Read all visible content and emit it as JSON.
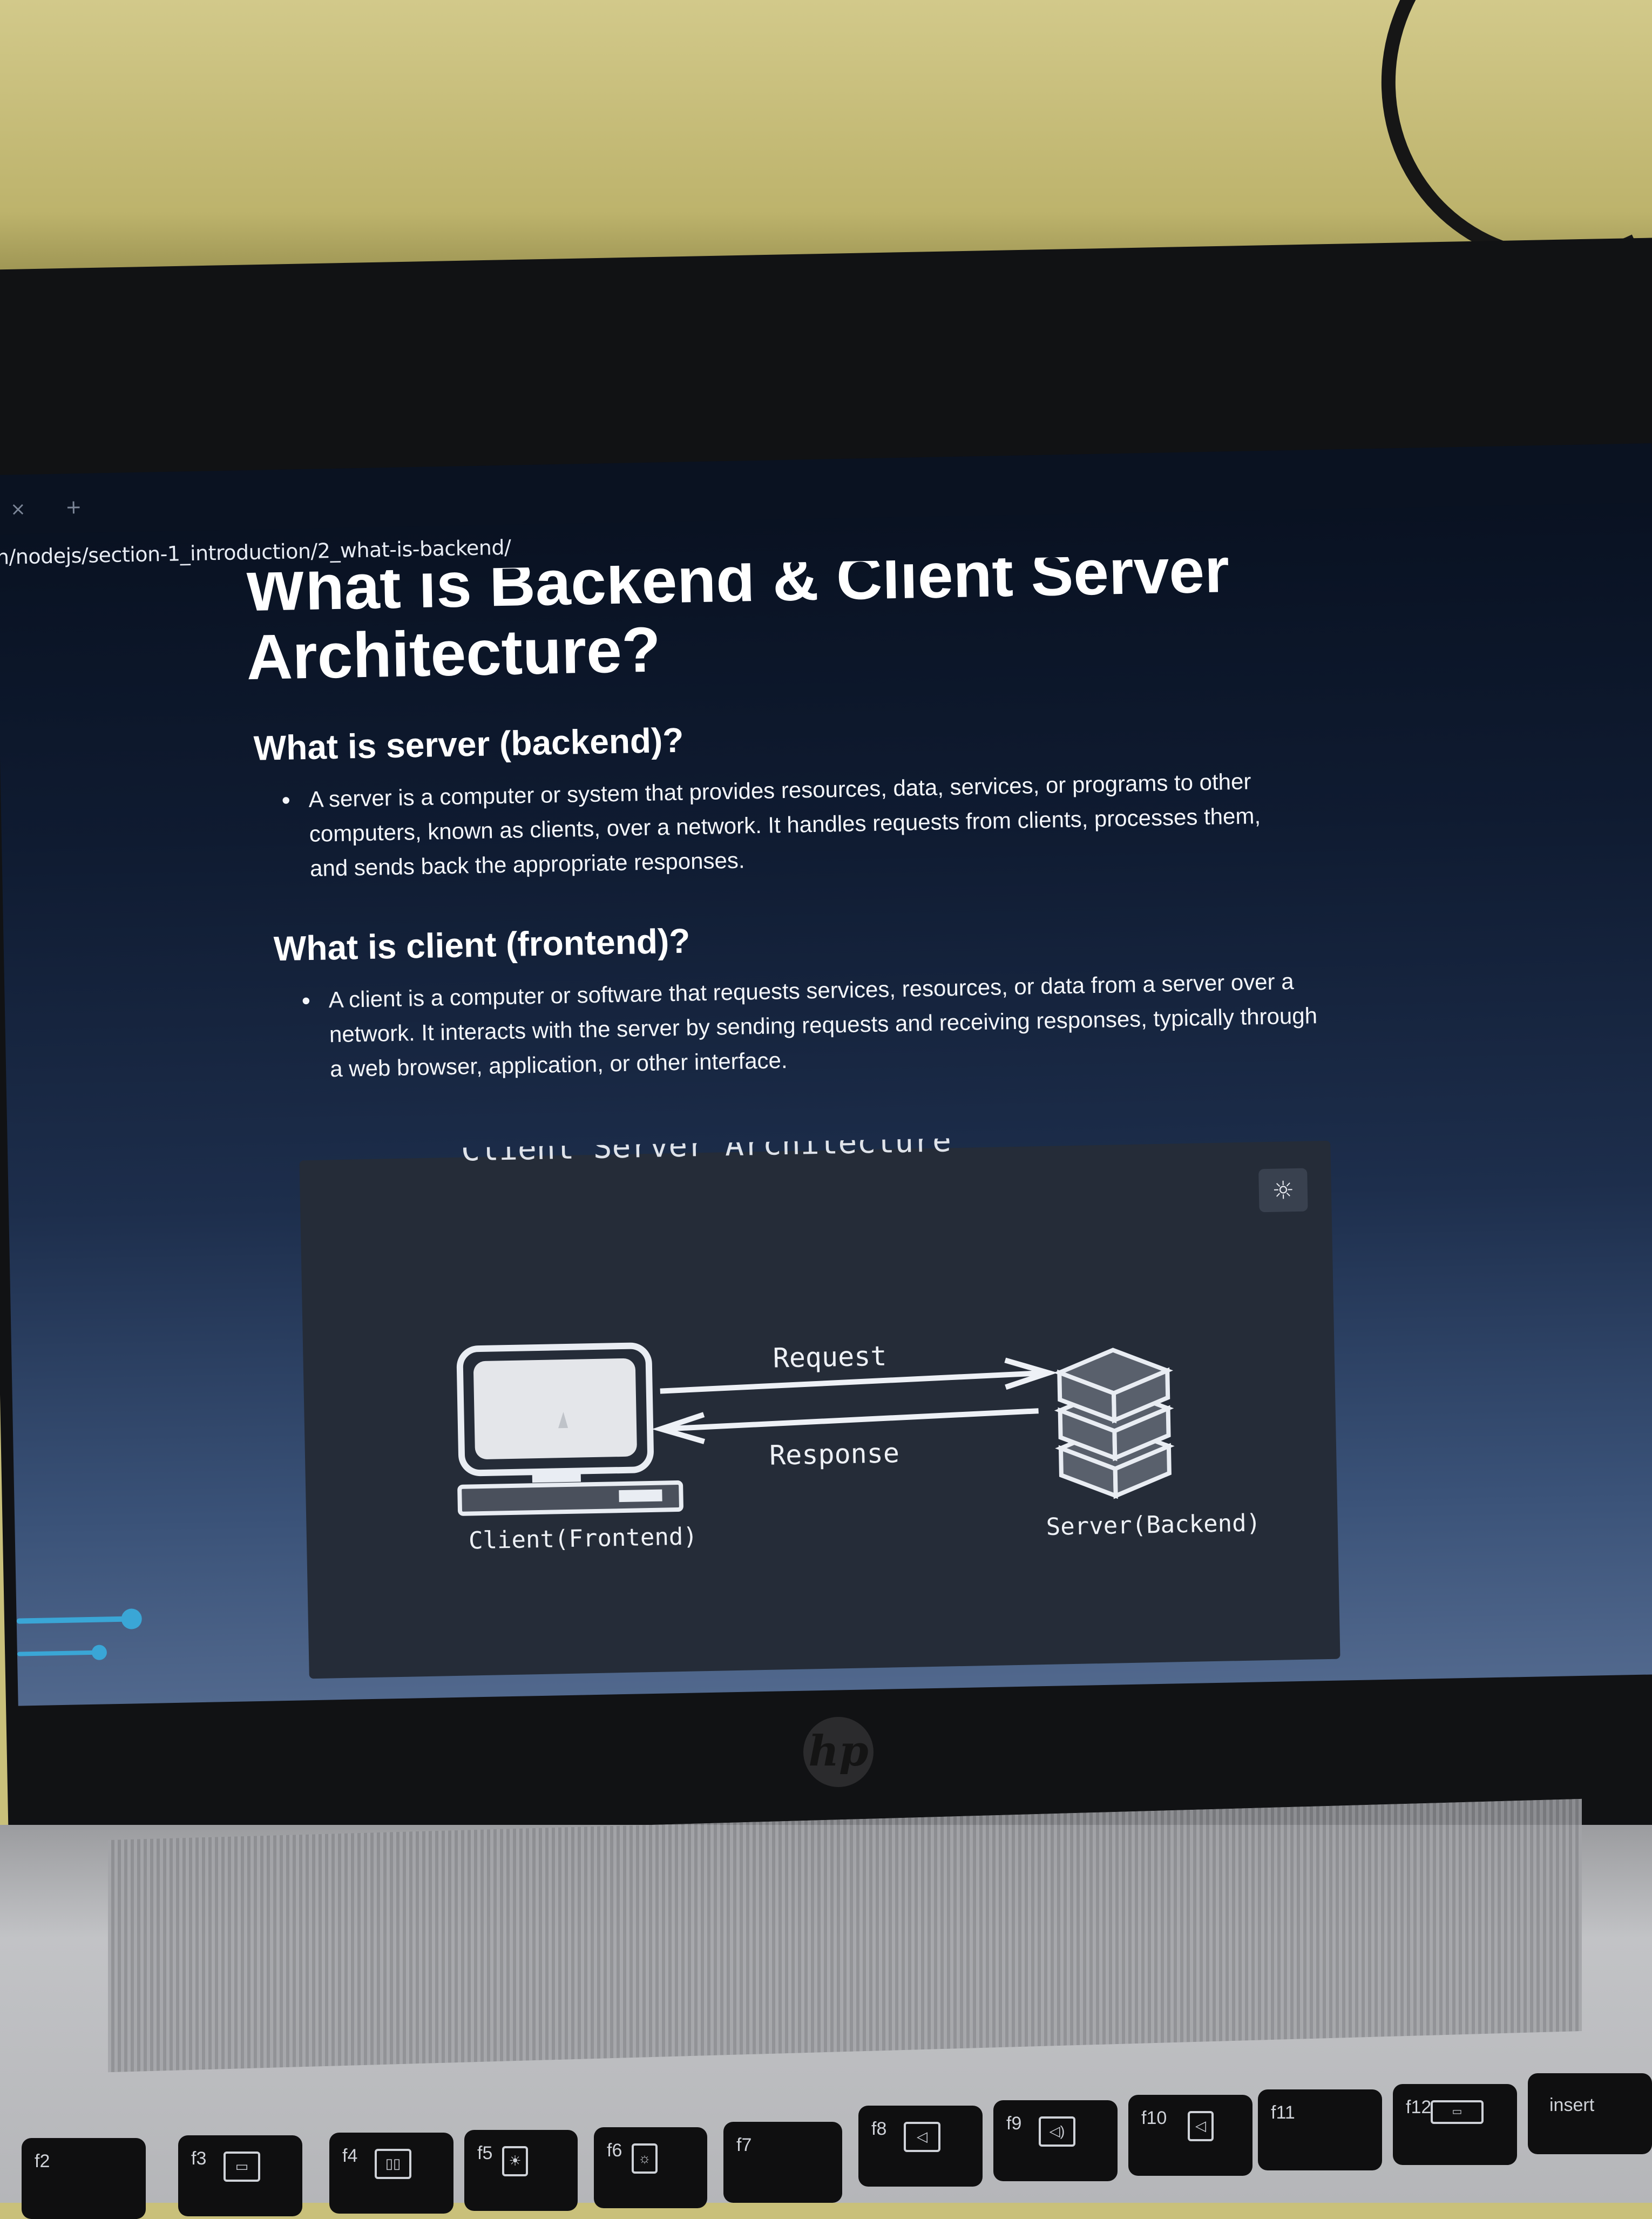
{
  "browser": {
    "tab_close": "×",
    "tab_new": "+",
    "url": "n/nodejs/section-1_introduction/2_what-is-backend/"
  },
  "article": {
    "title_line1": "What is Backend & Client Server",
    "title_line2": "Architecture?",
    "sections": [
      {
        "heading": "What is server (backend)?",
        "bullets": [
          "A server is a computer or system that provides resources, data, services, or programs to other computers, known as clients, over a network. It handles requests from clients, processes them, and sends back the appropriate responses."
        ]
      },
      {
        "heading": "What is client (frontend)?",
        "bullets": [
          "A client is a computer or software that requests services, resources, or data from a server over a network. It interacts with the server by sending requests and receiving responses, typically through a web browser, application, or other interface."
        ]
      }
    ]
  },
  "diagram": {
    "partial_heading": "Client Server Architecture",
    "theme_toggle_icon": "☼",
    "request_label": "Request",
    "response_label": "Response",
    "client_label": "Client(Frontend)",
    "server_label": "Server(Backend)"
  },
  "device": {
    "brand_logo": "hp"
  },
  "keyboard": {
    "keys": [
      "f2",
      "f3",
      "f4",
      "f5",
      "f6",
      "f7",
      "f8",
      "f9",
      "f10",
      "f11",
      "f12",
      "insert"
    ]
  },
  "colors": {
    "slider_accent": "#3aa6d6",
    "page_background_top": "#08101f",
    "page_background_bottom": "#51688d",
    "diagram_background": "#252c38"
  }
}
